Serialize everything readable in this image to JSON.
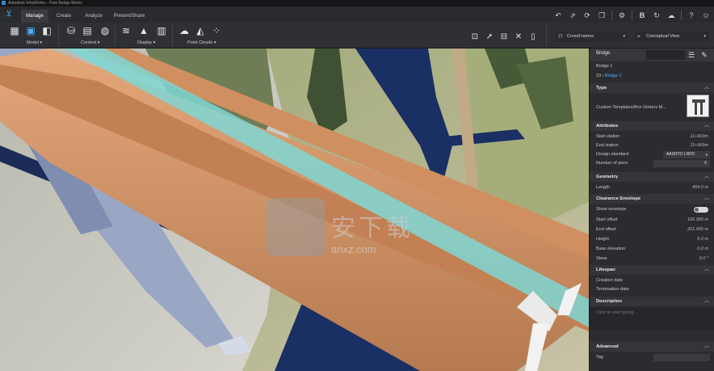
{
  "window": {
    "title": "Autodesk InfraWorks - Park Bridge Metric"
  },
  "tabs": [
    {
      "label": "Manage",
      "active": true
    },
    {
      "label": "Create",
      "active": false
    },
    {
      "label": "Analyze",
      "active": false
    },
    {
      "label": "Present/Share",
      "active": false
    }
  ],
  "ribbon": {
    "groups": {
      "model": "Model",
      "content": "Content",
      "display": "Display",
      "point_clouds": "Point Clouds"
    },
    "style_dropdown": "CrossFrames",
    "view_dropdown": "Conceptual View"
  },
  "panel": {
    "header_title": "Bridge",
    "object_name": "Bridge 1",
    "breadcrumb_root": "23",
    "breadcrumb_current": "Bridge 1",
    "sections": {
      "type": "Type",
      "attributes": "Attributes",
      "geometry": "Geometry",
      "clearance": "Clearance Envelope",
      "lifespan": "Lifespan",
      "description": "Description",
      "advanced": "Advanced"
    },
    "type_value": "Custom Templates/Box Girders M...",
    "attributes": {
      "start_station_label": "Start station",
      "start_station": "11+563m",
      "end_station_label": "End station",
      "end_station": "11+969m",
      "design_standard_label": "Design standard",
      "design_standard": "AASHTO LRFD",
      "num_piers_label": "Number of piers",
      "num_piers": "5"
    },
    "geometry": {
      "length_label": "Length",
      "length": "404.0  m"
    },
    "clearance": {
      "show_envelope_label": "Show envelope",
      "start_offset_label": "Start offset",
      "start_offset": "166.995  m",
      "end_offset_label": "End offset",
      "end_offset": "201.995  m",
      "height_label": "Height",
      "height": "5.0  m",
      "base_elevation_label": "Base elevation",
      "base_elevation": "0.0  m",
      "skew_label": "Skew",
      "skew": "0.0  °"
    },
    "lifespan": {
      "creation_label": "Creation date",
      "termination_label": "Termination date"
    },
    "description_placeholder": "Click to start typing...",
    "advanced": {
      "tag_label": "Tag"
    }
  },
  "watermark": {
    "text": "安下载",
    "sub": "anxz.com"
  },
  "colors": {
    "accent": "#38a7e6",
    "deck": "#d99a6c",
    "glass": "#7fd6d4",
    "water": "#1a2f63",
    "pier": "#9aa7c4"
  }
}
